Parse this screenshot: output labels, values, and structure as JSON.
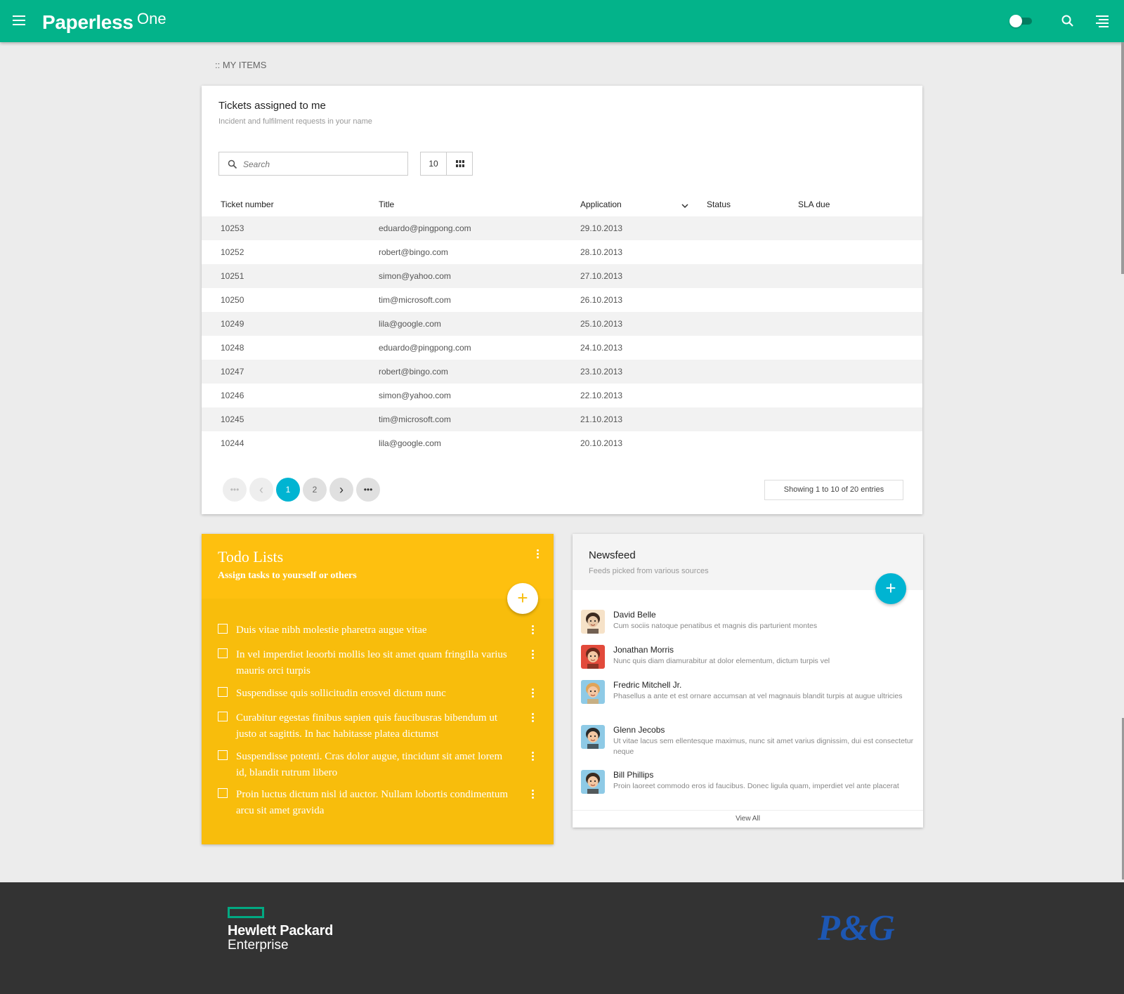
{
  "header": {
    "brand": "Paperless",
    "brand_sup": "One"
  },
  "breadcrumb": ":: MY ITEMS",
  "tickets": {
    "title": "Tickets assigned to me",
    "subtitle": "Incident and fulfilment requests in your name",
    "search_placeholder": "Search",
    "page_length": "10",
    "columns": [
      "Ticket number",
      "Title",
      "Application",
      "Status",
      "SLA due"
    ],
    "rows": [
      {
        "number": "10253",
        "title": "eduardo@pingpong.com",
        "application": "29.10.2013",
        "status": "",
        "sla": ""
      },
      {
        "number": "10252",
        "title": "robert@bingo.com",
        "application": "28.10.2013",
        "status": "",
        "sla": ""
      },
      {
        "number": "10251",
        "title": "simon@yahoo.com",
        "application": "27.10.2013",
        "status": "",
        "sla": ""
      },
      {
        "number": "10250",
        "title": "tim@microsoft.com",
        "application": "26.10.2013",
        "status": "",
        "sla": ""
      },
      {
        "number": "10249",
        "title": "lila@google.com",
        "application": "25.10.2013",
        "status": "",
        "sla": ""
      },
      {
        "number": "10248",
        "title": "eduardo@pingpong.com",
        "application": "24.10.2013",
        "status": "",
        "sla": ""
      },
      {
        "number": "10247",
        "title": "robert@bingo.com",
        "application": "23.10.2013",
        "status": "",
        "sla": ""
      },
      {
        "number": "10246",
        "title": "simon@yahoo.com",
        "application": "22.10.2013",
        "status": "",
        "sla": ""
      },
      {
        "number": "10245",
        "title": "tim@microsoft.com",
        "application": "21.10.2013",
        "status": "",
        "sla": ""
      },
      {
        "number": "10244",
        "title": "lila@google.com",
        "application": "20.10.2013",
        "status": "",
        "sla": ""
      }
    ],
    "pagination": {
      "first": "•••",
      "prev": "‹",
      "pages": [
        "1",
        "2"
      ],
      "active_page": "1",
      "next": "›",
      "last": "•••"
    },
    "showing": "Showing 1 to 10 of 20 entries"
  },
  "todo": {
    "title": "Todo Lists",
    "subtitle": "Assign tasks to yourself or others",
    "add_label": "+",
    "items": [
      "Duis vitae nibh molestie pharetra augue vitae",
      "In vel imperdiet leoorbi mollis leo sit amet quam fringilla varius mauris orci turpis",
      "Suspendisse quis sollicitudin erosvel dictum nunc",
      "Curabitur egestas finibus sapien quis faucibusras bibendum ut justo at sagittis. In hac habitasse platea dictumst",
      "Suspendisse potenti. Cras dolor augue, tincidunt sit amet lorem id, blandit rutrum libero",
      "Proin luctus dictum nisl id auctor. Nullam lobortis condimentum arcu sit amet gravida"
    ]
  },
  "newsfeed": {
    "title": "Newsfeed",
    "subtitle": "Feeds picked from various sources",
    "add_label": "+",
    "items": [
      {
        "name": "David Belle",
        "message": "Cum sociis natoque penatibus et magnis dis parturient montes",
        "avatar": "avatar-woman-dark-hair"
      },
      {
        "name": "Jonathan Morris",
        "message": "Nunc quis diam diamurabitur at dolor elementum, dictum turpis vel",
        "avatar": "avatar-man-red"
      },
      {
        "name": "Fredric Mitchell Jr.",
        "message": "Phasellus a ante et est ornare accumsan at vel magnauis blandit turpis at augue ultricies",
        "avatar": "avatar-woman-blonde"
      },
      {
        "name": "Glenn Jecobs",
        "message": "Ut vitae lacus sem ellentesque maximus, nunc sit amet varius dignissim, dui est consectetur neque",
        "avatar": "avatar-man-glasses"
      },
      {
        "name": "Bill Phillips",
        "message": "Proin laoreet commodo eros id faucibus. Donec ligula quam, imperdiet vel ante placerat",
        "avatar": "avatar-man-blue"
      }
    ],
    "view_all": "View All"
  },
  "footer": {
    "hpe_line1": "Hewlett Packard",
    "hpe_line2": "Enterprise",
    "pg_logo": "P&G"
  },
  "colors": {
    "header": "#03b38a",
    "accent_cyan": "#00b4d2",
    "todo_yellow": "#f8bd0c",
    "footer": "#333333",
    "pg_blue": "#1d57b3"
  }
}
